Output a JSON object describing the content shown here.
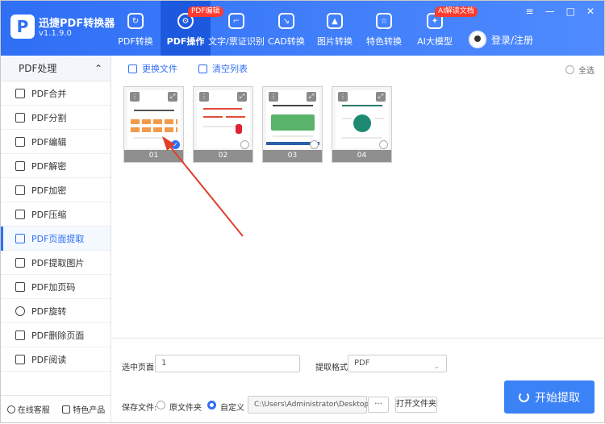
{
  "app": {
    "name": "迅捷PDF转换器",
    "version": "v1.1.9.0"
  },
  "nav": [
    {
      "label": "PDF转换",
      "badge": ""
    },
    {
      "label": "PDF操作",
      "badge": "PDF编辑"
    },
    {
      "label": "文字/票证识别",
      "badge": ""
    },
    {
      "label": "CAD转换",
      "badge": ""
    },
    {
      "label": "图片转换",
      "badge": ""
    },
    {
      "label": "特色转换",
      "badge": ""
    },
    {
      "label": "AI大模型",
      "badge": "AI解读文档"
    }
  ],
  "login": "登录/注册",
  "window_buttons": [
    "≡",
    "—",
    "□",
    "✕"
  ],
  "sidebar": {
    "header": "PDF处理",
    "items": [
      "PDF合并",
      "PDF分割",
      "PDF编辑",
      "PDF解密",
      "PDF加密",
      "PDF压缩",
      "PDF页面提取",
      "PDF提取图片",
      "PDF加页码",
      "PDF旋转",
      "PDF删除页面",
      "PDF阅读"
    ],
    "footer": [
      "在线客服",
      "特色产品"
    ]
  },
  "toolbar": {
    "replace": "更换文件",
    "clear": "清空列表",
    "select_all": "全选"
  },
  "thumbs": [
    {
      "num": "01",
      "checked": true
    },
    {
      "num": "02",
      "checked": false
    },
    {
      "num": "03",
      "checked": false
    },
    {
      "num": "04",
      "checked": false
    }
  ],
  "bottom": {
    "pages_label": "选中页面:",
    "pages_value": "1",
    "format_label": "提取格式:",
    "format_value": "PDF",
    "save_label": "保存文件:",
    "opt_source": "原文件夹",
    "opt_custom": "自定义",
    "path": "C:\\Users\\Administrator\\Desktop",
    "browse": "···",
    "open_folder": "打开文件夹",
    "start": "开始提取"
  },
  "colors": {
    "accent": "#2f6ff5",
    "badge": "#ff3b30",
    "arrow": "#e0402a"
  }
}
